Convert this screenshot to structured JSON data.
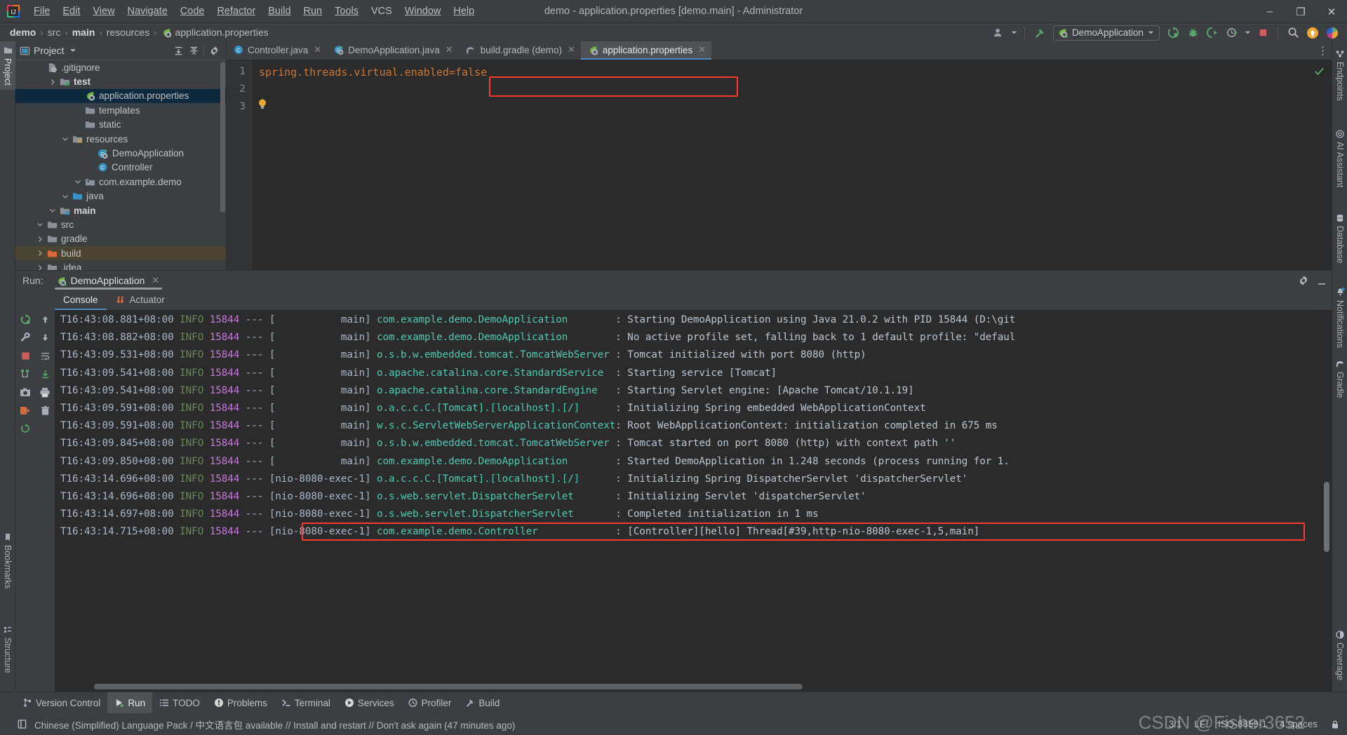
{
  "window": {
    "title": "demo - application.properties [demo.main] - Administrator",
    "logo": "intellij-idea-logo",
    "controls": [
      {
        "name": "minimize-button",
        "glyph": "–"
      },
      {
        "name": "maximize-button",
        "glyph": "❐"
      },
      {
        "name": "close-button",
        "glyph": "✕"
      }
    ]
  },
  "menubar": {
    "items": [
      {
        "label": "File",
        "mnemonic": "F"
      },
      {
        "label": "Edit",
        "mnemonic": "E"
      },
      {
        "label": "View",
        "mnemonic": "V"
      },
      {
        "label": "Navigate",
        "mnemonic": "N"
      },
      {
        "label": "Code",
        "mnemonic": "C"
      },
      {
        "label": "Refactor",
        "mnemonic": "R"
      },
      {
        "label": "Build",
        "mnemonic": "B"
      },
      {
        "label": "Run",
        "mnemonic": "u"
      },
      {
        "label": "Tools",
        "mnemonic": "T"
      },
      {
        "label": "VCS",
        "mnemonic": ""
      },
      {
        "label": "Window",
        "mnemonic": "W"
      },
      {
        "label": "Help",
        "mnemonic": "H"
      }
    ]
  },
  "breadcrumb": {
    "items": [
      "demo",
      "src",
      "main",
      "resources",
      "application.properties"
    ],
    "separator": "›",
    "bold": [
      true,
      false,
      true,
      false,
      false
    ],
    "file_icon": "spring-properties-icon"
  },
  "toolbar": {
    "account_icon": "user-account-icon",
    "account_chevron": "chevron-down-icon",
    "build_icon": "build-hammer-icon",
    "run_config": {
      "icon": "spring-boot-run-config-icon",
      "label": "DemoApplication",
      "chevron": "chevron-down-icon"
    },
    "buttons": [
      {
        "name": "run-button",
        "icon": "run-with-coverage-icon"
      },
      {
        "name": "debug-button",
        "icon": "debug-bug-icon"
      },
      {
        "name": "run-coverage-button",
        "icon": "coverage-run-icon"
      },
      {
        "name": "profiler-button",
        "icon": "profiler-clock-icon"
      },
      {
        "name": "profiler-dropdown",
        "icon": "chevron-down-icon"
      },
      {
        "name": "stop-button",
        "icon": "stop-square-icon"
      },
      {
        "name": "search-everywhere-button",
        "icon": "search-icon"
      },
      {
        "name": "updates-button",
        "icon": "update-arrow-icon"
      },
      {
        "name": "ai-assistant-button",
        "icon": "ai-assistant-icon"
      }
    ]
  },
  "left_strip": {
    "items": [
      {
        "label": "Project",
        "icon": "project-folder-icon",
        "active": true
      },
      {
        "label": "Bookmarks",
        "icon": "bookmark-icon",
        "active": false
      },
      {
        "label": "Structure",
        "icon": "structure-icon",
        "active": false
      }
    ]
  },
  "right_strip": {
    "items": [
      {
        "label": "Endpoints",
        "icon": "endpoints-icon"
      },
      {
        "label": "AI Assistant",
        "icon": "ai-assistant-icon"
      },
      {
        "label": "Database",
        "icon": "database-icon"
      },
      {
        "label": "Notifications",
        "icon": "notifications-bell-icon"
      },
      {
        "label": "Gradle",
        "icon": "gradle-elephant-icon"
      },
      {
        "label": "Coverage",
        "icon": "coverage-icon"
      }
    ]
  },
  "project_panel": {
    "title": "Project",
    "title_icon": "project-view-icon",
    "title_chevron": "chevron-down-icon",
    "actions": [
      {
        "name": "expand-all-button",
        "icon": "expand-all-icon"
      },
      {
        "name": "collapse-all-button",
        "icon": "collapse-all-icon"
      },
      {
        "name": "project-settings-button",
        "icon": "gear-icon"
      }
    ],
    "tree": [
      {
        "label": ".idea",
        "indent": 1,
        "twisty": "›",
        "icon": "folder-grey-icon",
        "bold": false,
        "state": "none"
      },
      {
        "label": "build",
        "indent": 1,
        "twisty": "›",
        "icon": "folder-orange-icon",
        "bold": false,
        "state": "build"
      },
      {
        "label": "gradle",
        "indent": 1,
        "twisty": "›",
        "icon": "folder-grey-icon",
        "bold": false,
        "state": "none"
      },
      {
        "label": "src",
        "indent": 1,
        "twisty": "⌄",
        "icon": "folder-grey-icon",
        "bold": false,
        "state": "none"
      },
      {
        "label": "main",
        "indent": 2,
        "twisty": "⌄",
        "icon": "folder-source-icon",
        "bold": true,
        "state": "none"
      },
      {
        "label": "java",
        "indent": 3,
        "twisty": "⌄",
        "icon": "folder-blue-icon",
        "bold": false,
        "state": "none"
      },
      {
        "label": "com.example.demo",
        "indent": 4,
        "twisty": "⌄",
        "icon": "package-icon",
        "bold": false,
        "state": "none"
      },
      {
        "label": "Controller",
        "indent": 5,
        "twisty": "",
        "icon": "java-class-icon",
        "bold": false,
        "state": "none"
      },
      {
        "label": "DemoApplication",
        "indent": 5,
        "twisty": "",
        "icon": "spring-boot-class-icon",
        "bold": false,
        "state": "none"
      },
      {
        "label": "resources",
        "indent": 3,
        "twisty": "⌄",
        "icon": "folder-resources-icon",
        "bold": false,
        "state": "none"
      },
      {
        "label": "static",
        "indent": 4,
        "twisty": "",
        "icon": "folder-grey-icon",
        "bold": false,
        "state": "none"
      },
      {
        "label": "templates",
        "indent": 4,
        "twisty": "",
        "icon": "folder-grey-icon",
        "bold": false,
        "state": "none"
      },
      {
        "label": "application.properties",
        "indent": 4,
        "twisty": "",
        "icon": "spring-properties-icon",
        "bold": false,
        "state": "selected"
      },
      {
        "label": "test",
        "indent": 2,
        "twisty": "›",
        "icon": "folder-test-icon",
        "bold": true,
        "state": "none"
      },
      {
        "label": ".gitignore",
        "indent": 1,
        "twisty": "",
        "icon": "gitignore-file-icon",
        "bold": false,
        "state": "none"
      }
    ]
  },
  "editor": {
    "tabs": [
      {
        "label": "Controller.java",
        "icon": "java-class-icon",
        "active": false,
        "close": "✕"
      },
      {
        "label": "DemoApplication.java",
        "icon": "spring-boot-class-icon",
        "active": false,
        "close": "✕"
      },
      {
        "label": "build.gradle (demo)",
        "icon": "gradle-elephant-icon",
        "active": false,
        "close": "✕"
      },
      {
        "label": "application.properties",
        "icon": "spring-properties-icon",
        "active": true,
        "close": "✕"
      }
    ],
    "more_icon": "more-vertical-icon",
    "line_numbers": [
      "1",
      "2",
      "3"
    ],
    "lines": [
      "spring.threads.virtual.enabled=false",
      "",
      ""
    ],
    "bulb_icon": "intention-bulb-icon",
    "inspection_status_icon": "inspection-ok-check-icon",
    "highlight_color": "#ff3b30"
  },
  "run_panel": {
    "label": "Run:",
    "tab": {
      "label": "DemoApplication",
      "icon": "spring-boot-run-config-icon",
      "close": "✕"
    },
    "settings_icon": "gear-icon",
    "hide_icon": "minimize-icon",
    "tabs": [
      {
        "label": "Console",
        "icon": "",
        "active": true
      },
      {
        "label": "Actuator",
        "icon": "actuator-icon",
        "active": false
      }
    ],
    "side_buttons": [
      {
        "name": "rerun-button",
        "icon": "rerun-green-icon"
      },
      {
        "name": "scroll-up-button",
        "icon": "arrow-up-icon"
      },
      {
        "name": "wrench-button",
        "icon": "wrench-icon"
      },
      {
        "name": "scroll-down-button",
        "icon": "arrow-down-icon"
      },
      {
        "name": "stop-button",
        "icon": "stop-red-square-icon"
      },
      {
        "name": "soft-wrap-button",
        "icon": "soft-wrap-icon"
      },
      {
        "name": "thread-dump-button",
        "icon": "thread-dump-icon"
      },
      {
        "name": "scroll-to-end-button",
        "icon": "scroll-to-end-icon"
      },
      {
        "name": "screenshot-button",
        "icon": "camera-icon"
      },
      {
        "name": "print-button",
        "icon": "print-icon"
      },
      {
        "name": "export-button",
        "icon": "export-icon"
      },
      {
        "name": "clear-all-button",
        "icon": "trash-icon"
      },
      {
        "name": "restart-button",
        "icon": "restart-icon"
      }
    ],
    "console_lines": [
      {
        "time": "T16:43:08.881+08:00",
        "level": "INFO",
        "pid": "15844",
        "dash": "---",
        "thread": "[           main]",
        "logger": "com.example.demo.DemoApplication",
        "message": ": Starting DemoApplication using Java 21.0.2 with PID 15844 (D:\\git"
      },
      {
        "time": "T16:43:08.882+08:00",
        "level": "INFO",
        "pid": "15844",
        "dash": "---",
        "thread": "[           main]",
        "logger": "com.example.demo.DemoApplication",
        "message": ": No active profile set, falling back to 1 default profile: \"defaul"
      },
      {
        "time": "T16:43:09.531+08:00",
        "level": "INFO",
        "pid": "15844",
        "dash": "---",
        "thread": "[           main]",
        "logger": "o.s.b.w.embedded.tomcat.TomcatWebServer",
        "message": ": Tomcat initialized with port 8080 (http)"
      },
      {
        "time": "T16:43:09.541+08:00",
        "level": "INFO",
        "pid": "15844",
        "dash": "---",
        "thread": "[           main]",
        "logger": "o.apache.catalina.core.StandardService",
        "message": ": Starting service [Tomcat]"
      },
      {
        "time": "T16:43:09.541+08:00",
        "level": "INFO",
        "pid": "15844",
        "dash": "---",
        "thread": "[           main]",
        "logger": "o.apache.catalina.core.StandardEngine",
        "message": ": Starting Servlet engine: [Apache Tomcat/10.1.19]"
      },
      {
        "time": "T16:43:09.591+08:00",
        "level": "INFO",
        "pid": "15844",
        "dash": "---",
        "thread": "[           main]",
        "logger": "o.a.c.c.C.[Tomcat].[localhost].[/]",
        "message": ": Initializing Spring embedded WebApplicationContext"
      },
      {
        "time": "T16:43:09.591+08:00",
        "level": "INFO",
        "pid": "15844",
        "dash": "---",
        "thread": "[           main]",
        "logger": "w.s.c.ServletWebServerApplicationContext",
        "message": ": Root WebApplicationContext: initialization completed in 675 ms"
      },
      {
        "time": "T16:43:09.845+08:00",
        "level": "INFO",
        "pid": "15844",
        "dash": "---",
        "thread": "[           main]",
        "logger": "o.s.b.w.embedded.tomcat.TomcatWebServer",
        "message": ": Tomcat started on port 8080 (http) with context path ''"
      },
      {
        "time": "T16:43:09.850+08:00",
        "level": "INFO",
        "pid": "15844",
        "dash": "---",
        "thread": "[           main]",
        "logger": "com.example.demo.DemoApplication",
        "message": ": Started DemoApplication in 1.248 seconds (process running for 1."
      },
      {
        "time": "T16:43:14.696+08:00",
        "level": "INFO",
        "pid": "15844",
        "dash": "---",
        "thread": "[nio-8080-exec-1]",
        "logger": "o.a.c.c.C.[Tomcat].[localhost].[/]",
        "message": ": Initializing Spring DispatcherServlet 'dispatcherServlet'"
      },
      {
        "time": "T16:43:14.696+08:00",
        "level": "INFO",
        "pid": "15844",
        "dash": "---",
        "thread": "[nio-8080-exec-1]",
        "logger": "o.s.web.servlet.DispatcherServlet",
        "message": ": Initializing Servlet 'dispatcherServlet'"
      },
      {
        "time": "T16:43:14.697+08:00",
        "level": "INFO",
        "pid": "15844",
        "dash": "---",
        "thread": "[nio-8080-exec-1]",
        "logger": "o.s.web.servlet.DispatcherServlet",
        "message": ": Completed initialization in 1 ms"
      },
      {
        "time": "T16:43:14.715+08:00",
        "level": "INFO",
        "pid": "15844",
        "dash": "---",
        "thread": "[nio-8080-exec-1]",
        "logger": "com.example.demo.Controller",
        "message": ": [Controller][hello] Thread[#39,http-nio-8080-exec-1,5,main]"
      }
    ],
    "highlighted_line_index": 12,
    "highlight_color": "#ff3b30"
  },
  "toolwindow_bar": {
    "items": [
      {
        "label": "Version Control",
        "icon": "version-control-icon",
        "active": false
      },
      {
        "label": "Run",
        "icon": "run-triangle-icon",
        "active": true
      },
      {
        "label": "TODO",
        "icon": "todo-list-icon",
        "active": false
      },
      {
        "label": "Problems",
        "icon": "problems-icon",
        "active": false
      },
      {
        "label": "Terminal",
        "icon": "terminal-icon",
        "active": false
      },
      {
        "label": "Services",
        "icon": "services-icon",
        "active": false
      },
      {
        "label": "Profiler",
        "icon": "profiler-icon",
        "active": false
      },
      {
        "label": "Build",
        "icon": "build-hammer-icon",
        "active": false
      }
    ]
  },
  "status_bar": {
    "notification_icon": "notification-plugin-icon",
    "message": "Chinese (Simplified) Language Pack / 中文语言包 available // Install and restart // Don't ask again (47 minutes ago)",
    "caret_position": "3:1",
    "line_separator": "LF",
    "encoding": "ISO-8859-1",
    "indent": "4 spaces",
    "lock_icon": "lock-icon",
    "watermark": "CSDN @Fisher3652"
  },
  "colors": {
    "background": "#3c3f41",
    "editor_background": "#2b2b2b",
    "accent_blue": "#4a88c7",
    "selection_blue": "#0d293e",
    "highlight_red": "#ff3b30",
    "code_orange": "#cc7832",
    "log_green": "#6a8759",
    "log_purple": "#c678dd",
    "log_teal": "#4ec9b0"
  }
}
